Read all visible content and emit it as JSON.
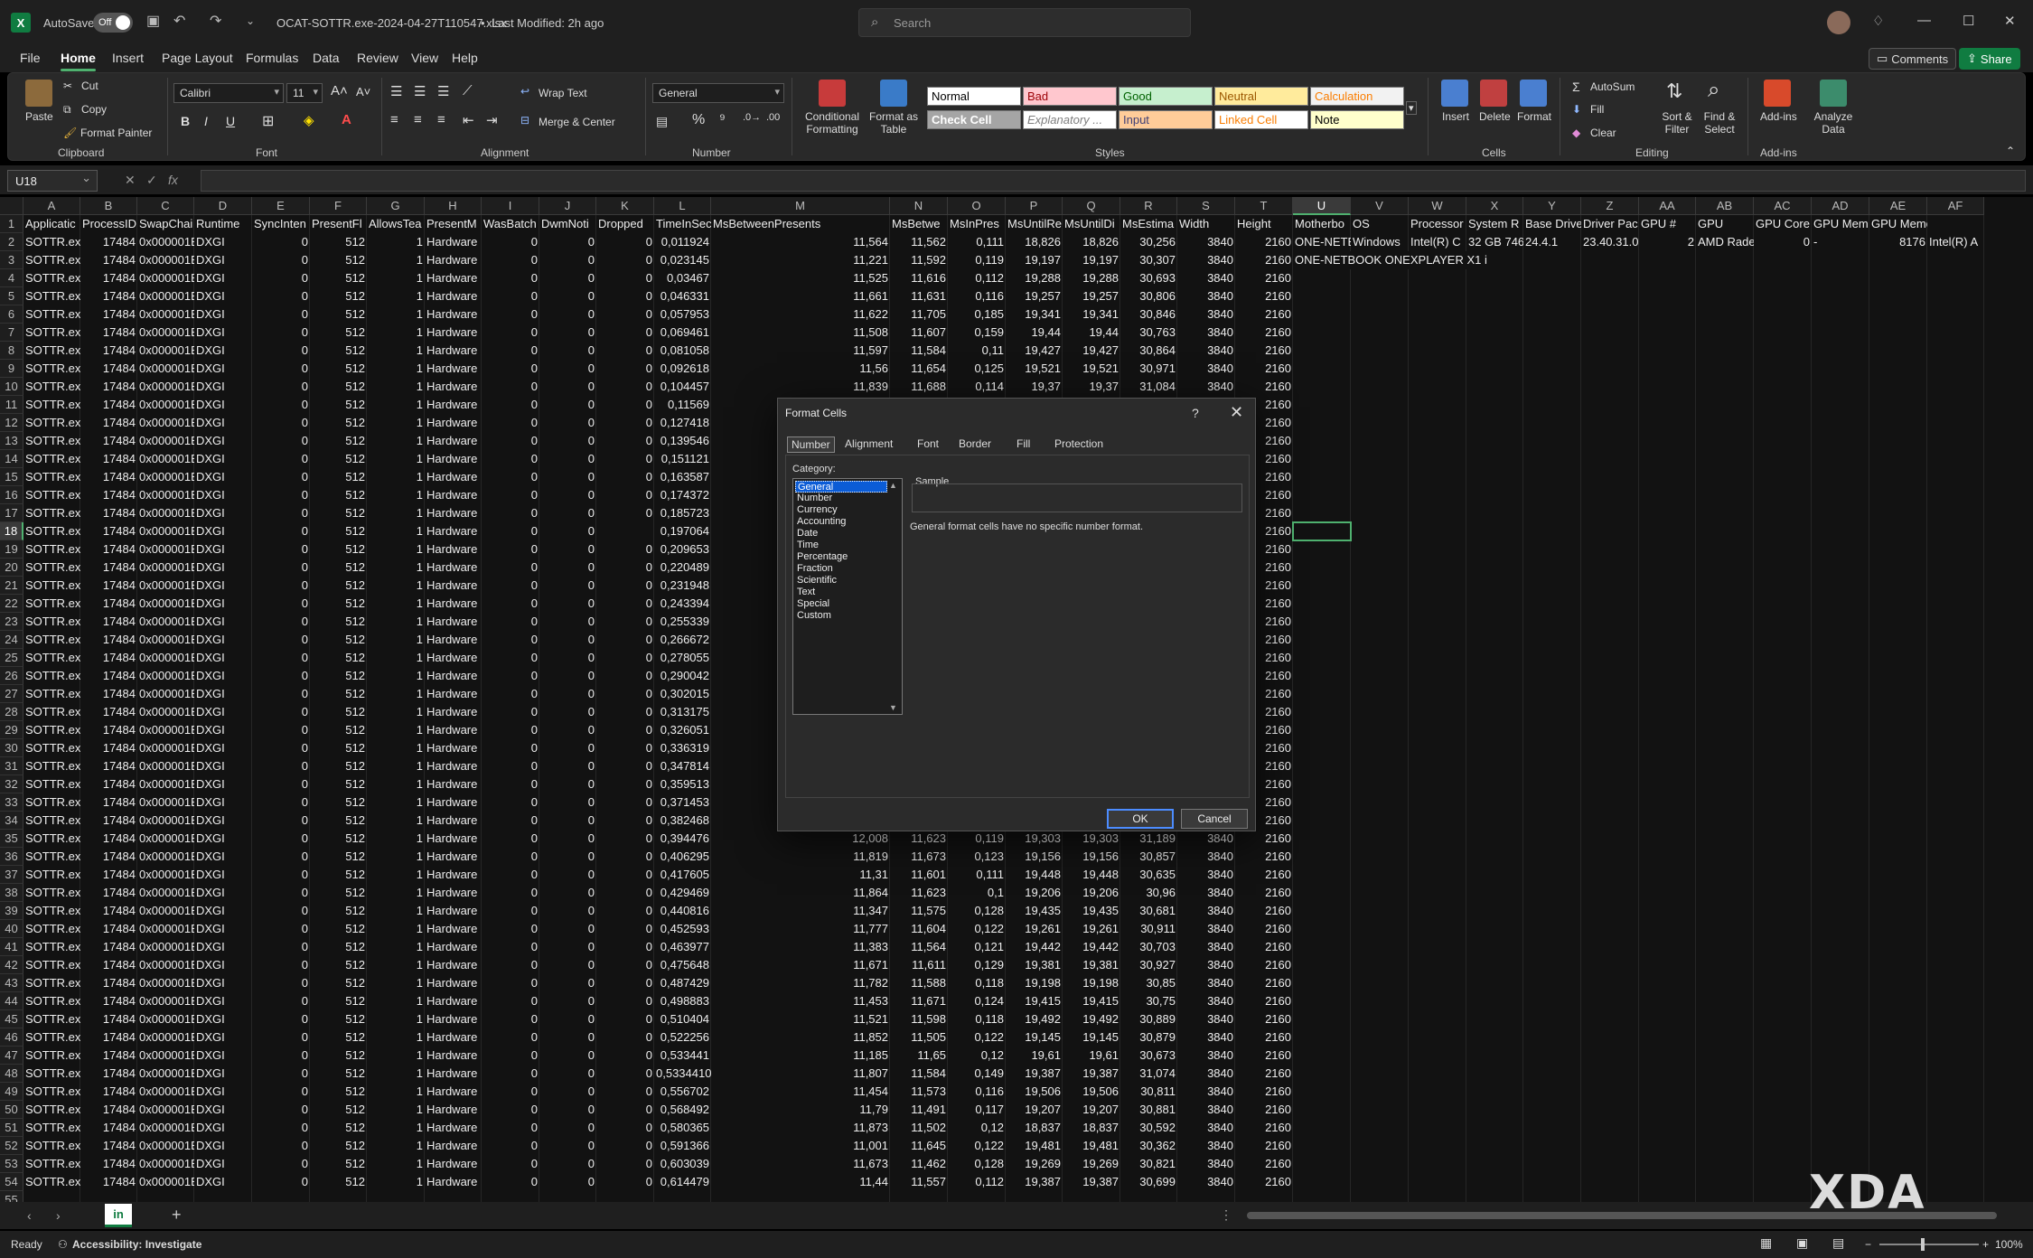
{
  "app": {
    "autosave_label": "AutoSave",
    "autosave_state": "Off",
    "file_name": "OCAT-SOTTR.exe-2024-04-27T110547.xlsx",
    "modified": "Last Modified: 2h ago",
    "search_placeholder": "Search"
  },
  "menu": {
    "tabs": [
      "File",
      "Home",
      "Insert",
      "Page Layout",
      "Formulas",
      "Data",
      "Review",
      "View",
      "Help"
    ],
    "comments": "Comments",
    "share": "Share"
  },
  "ribbon": {
    "clipboard": {
      "label": "Clipboard",
      "paste": "Paste",
      "cut": "Cut",
      "copy": "Copy",
      "format_painter": "Format Painter"
    },
    "font": {
      "label": "Font",
      "name": "Calibri",
      "size": "11"
    },
    "alignment": {
      "label": "Alignment",
      "wrap": "Wrap Text",
      "merge": "Merge & Center"
    },
    "number": {
      "label": "Number",
      "format": "General"
    },
    "styles": {
      "label": "Styles",
      "conditional": "Conditional Formatting",
      "format_table": "Format as Table",
      "cells": [
        {
          "text": "Normal",
          "bg": "#ffffff",
          "fg": "#000000"
        },
        {
          "text": "Bad",
          "bg": "#ffc7ce",
          "fg": "#9c0006"
        },
        {
          "text": "Good",
          "bg": "#c6efce",
          "fg": "#006100"
        },
        {
          "text": "Neutral",
          "bg": "#ffeb9c",
          "fg": "#9c5700"
        },
        {
          "text": "Calculation",
          "bg": "#f2f2f2",
          "fg": "#fa7d00"
        },
        {
          "text": "Check Cell",
          "bg": "#a5a5a5",
          "fg": "#ffffff"
        },
        {
          "text": "Explanatory ...",
          "bg": "#ffffff",
          "fg": "#7f7f7f"
        },
        {
          "text": "Input",
          "bg": "#ffcc99",
          "fg": "#3f3f76"
        },
        {
          "text": "Linked Cell",
          "bg": "#ffffff",
          "fg": "#fa7d00"
        },
        {
          "text": "Note",
          "bg": "#ffffcc",
          "fg": "#000000"
        }
      ]
    },
    "cells": {
      "label": "Cells",
      "insert": "Insert",
      "delete": "Delete",
      "format": "Format"
    },
    "editing": {
      "label": "Editing",
      "autosum": "AutoSum",
      "fill": "Fill",
      "clear": "Clear",
      "sort": "Sort & Filter",
      "find": "Find & Select"
    },
    "addins": {
      "label": "Add-ins",
      "addins": "Add-ins",
      "analyze": "Analyze Data"
    }
  },
  "formula_bar": {
    "name_box": "U18",
    "fx": "fx",
    "value": ""
  },
  "grid": {
    "columns": [
      {
        "letter": "A",
        "w": 63
      },
      {
        "letter": "B",
        "w": 63
      },
      {
        "letter": "C",
        "w": 63
      },
      {
        "letter": "D",
        "w": 64
      },
      {
        "letter": "E",
        "w": 64
      },
      {
        "letter": "F",
        "w": 63
      },
      {
        "letter": "G",
        "w": 64
      },
      {
        "letter": "H",
        "w": 63
      },
      {
        "letter": "I",
        "w": 64
      },
      {
        "letter": "J",
        "w": 63
      },
      {
        "letter": "K",
        "w": 64
      },
      {
        "letter": "L",
        "w": 63
      },
      {
        "letter": "M",
        "w": 198
      },
      {
        "letter": "N",
        "w": 64
      },
      {
        "letter": "O",
        "w": 64
      },
      {
        "letter": "P",
        "w": 63
      },
      {
        "letter": "Q",
        "w": 64
      },
      {
        "letter": "R",
        "w": 63
      },
      {
        "letter": "S",
        "w": 64
      },
      {
        "letter": "T",
        "w": 64
      },
      {
        "letter": "U",
        "w": 64
      },
      {
        "letter": "V",
        "w": 64
      },
      {
        "letter": "W",
        "w": 64
      },
      {
        "letter": "X",
        "w": 63
      },
      {
        "letter": "Y",
        "w": 64
      },
      {
        "letter": "Z",
        "w": 64
      },
      {
        "letter": "AA",
        "w": 63
      },
      {
        "letter": "AB",
        "w": 64
      },
      {
        "letter": "AC",
        "w": 64
      },
      {
        "letter": "AD",
        "w": 64
      },
      {
        "letter": "AE",
        "w": 64
      },
      {
        "letter": "AF",
        "w": 63
      }
    ],
    "selected_col": "U",
    "selected_row": 18,
    "header_row": [
      "Applicatic",
      "ProcessID",
      "SwapChai",
      "Runtime",
      "SyncInten",
      "PresentFl",
      "AllowsTea",
      "PresentM",
      "WasBatch",
      "DwmNoti",
      "Dropped",
      "TimeInSec",
      "MsBetweenPresents",
      "MsBetwe",
      "MsInPres",
      "MsUntilRe",
      "MsUntilDi",
      "MsEstima",
      "Width",
      "Height",
      "Motherbo",
      "OS",
      "Processor",
      "System R",
      "Base Drive",
      "Driver Pac",
      "GPU #",
      "GPU",
      "GPU Core",
      "GPU Mem",
      "GPU Memory (MB)",
      ""
    ],
    "extra_row2": [
      "ONE-NETE",
      "Windows",
      "Intel(R) C",
      "32 GB 746",
      "24.4.1",
      "23.40.31.0",
      "2",
      "AMD Rade",
      "0",
      "-",
      "8176",
      "Intel(R) A"
    ],
    "extra_row3": [
      "ONE-NETBOOK ONEXPLAYER X1 i"
    ],
    "common": {
      "a": "SOTTR.exe",
      "b": "17484",
      "c": "0x000001E",
      "d": "DXGI",
      "e": "0",
      "f": "512",
      "g": "1",
      "h": "Hardware",
      "i": "0",
      "j": "0",
      "k": "0",
      "s": "3840",
      "t": "2160"
    },
    "time": [
      "0,011924",
      "0,023145",
      "0,03467",
      "0,046331",
      "0,057953",
      "0,069461",
      "0,081058",
      "0,092618",
      "0,104457",
      "0,11569",
      "0,127418",
      "0,139546",
      "0,151121",
      "0,163587",
      "0,174372",
      "0,185723",
      "0,197064",
      "0,209653",
      "0,220489",
      "0,231948",
      "0,243394",
      "0,255339",
      "0,266672",
      "0,278055",
      "0,290042",
      "0,302015",
      "0,313175",
      "0,326051",
      "0,336319",
      "0,347814",
      "0,359513",
      "0,371453",
      "0,382468",
      "0,394476",
      "0,406295",
      "0,417605",
      "0,429469",
      "0,440816",
      "0,452593",
      "0,463977",
      "0,475648",
      "0,487429",
      "0,498883",
      "0,510404",
      "0,522256",
      "0,533441",
      "0,5334410",
      "0,556702",
      "0,568492",
      "0,580365",
      "0,591366",
      "0,603039",
      "0,614479"
    ],
    "metrics": [
      [
        "11,564",
        "11,562",
        "0,111",
        "18,826",
        "18,826",
        "30,256"
      ],
      [
        "11,221",
        "11,592",
        "0,119",
        "19,197",
        "19,197",
        "30,307"
      ],
      [
        "11,525",
        "11,616",
        "0,112",
        "19,288",
        "19,288",
        "30,693"
      ],
      [
        "11,661",
        "11,631",
        "0,116",
        "19,257",
        "19,257",
        "30,806"
      ],
      [
        "11,622",
        "11,705",
        "0,185",
        "19,341",
        "19,341",
        "30,846"
      ],
      [
        "11,508",
        "11,607",
        "0,159",
        "19,44",
        "19,44",
        "30,763"
      ],
      [
        "11,597",
        "11,584",
        "0,11",
        "19,427",
        "19,427",
        "30,864"
      ],
      [
        "11,56",
        "11,654",
        "0,125",
        "19,521",
        "19,521",
        "30,971"
      ],
      [
        "11,839",
        "11,688",
        "0,114",
        "19,37",
        "19,37",
        "31,084"
      ]
    ],
    "metrics_lower": [
      [
        "12,008",
        "11,623",
        "0,119",
        "19,303",
        "19,303",
        "31,189"
      ],
      [
        "11,819",
        "11,673",
        "0,123",
        "19,156",
        "19,156",
        "30,857"
      ],
      [
        "11,31",
        "11,601",
        "0,111",
        "19,448",
        "19,448",
        "30,635"
      ],
      [
        "11,864",
        "11,623",
        "0,1",
        "19,206",
        "19,206",
        "30,96"
      ],
      [
        "11,347",
        "11,575",
        "0,128",
        "19,435",
        "19,435",
        "30,681"
      ],
      [
        "11,777",
        "11,604",
        "0,122",
        "19,261",
        "19,261",
        "30,911"
      ],
      [
        "11,383",
        "11,564",
        "0,121",
        "19,442",
        "19,442",
        "30,703"
      ],
      [
        "11,671",
        "11,611",
        "0,129",
        "19,381",
        "19,381",
        "30,927"
      ],
      [
        "11,782",
        "11,588",
        "0,118",
        "19,198",
        "19,198",
        "30,85"
      ],
      [
        "11,453",
        "11,671",
        "0,124",
        "19,415",
        "19,415",
        "30,75"
      ],
      [
        "11,521",
        "11,598",
        "0,118",
        "19,492",
        "19,492",
        "30,889"
      ],
      [
        "11,852",
        "11,505",
        "0,122",
        "19,145",
        "19,145",
        "30,879"
      ],
      [
        "11,185",
        "11,65",
        "0,12",
        "19,61",
        "19,61",
        "30,673"
      ],
      [
        "11,807",
        "11,584",
        "0,149",
        "19,387",
        "19,387",
        "31,074"
      ],
      [
        "11,454",
        "11,573",
        "0,116",
        "19,506",
        "19,506",
        "30,811"
      ],
      [
        "11,79",
        "11,491",
        "0,117",
        "19,207",
        "19,207",
        "30,881"
      ],
      [
        "11,873",
        "11,502",
        "0,12",
        "18,837",
        "18,837",
        "30,592"
      ],
      [
        "11,001",
        "11,645",
        "0,122",
        "19,481",
        "19,481",
        "30,362"
      ],
      [
        "11,673",
        "11,462",
        "0,128",
        "19,269",
        "19,269",
        "30,821"
      ],
      [
        "11,44",
        "11,557",
        "0,112",
        "19,387",
        "19,387",
        "30,699"
      ]
    ]
  },
  "dialog": {
    "title": "Format Cells",
    "help": "?",
    "close": "✕",
    "tabs": [
      "Number",
      "Alignment",
      "Font",
      "Border",
      "Fill",
      "Protection"
    ],
    "category_label": "Category:",
    "categories": [
      "General",
      "Number",
      "Currency",
      "Accounting",
      "Date",
      "Time",
      "Percentage",
      "Fraction",
      "Scientific",
      "Text",
      "Special",
      "Custom"
    ],
    "selected": "General",
    "sample_label": "Sample",
    "description": "General format cells have no specific number format.",
    "ok": "OK",
    "cancel": "Cancel"
  },
  "sheet": {
    "tab": "in"
  },
  "status": {
    "ready": "Ready",
    "accessibility": "Accessibility: Investigate",
    "zoom": "100%"
  },
  "watermark": "XDA"
}
